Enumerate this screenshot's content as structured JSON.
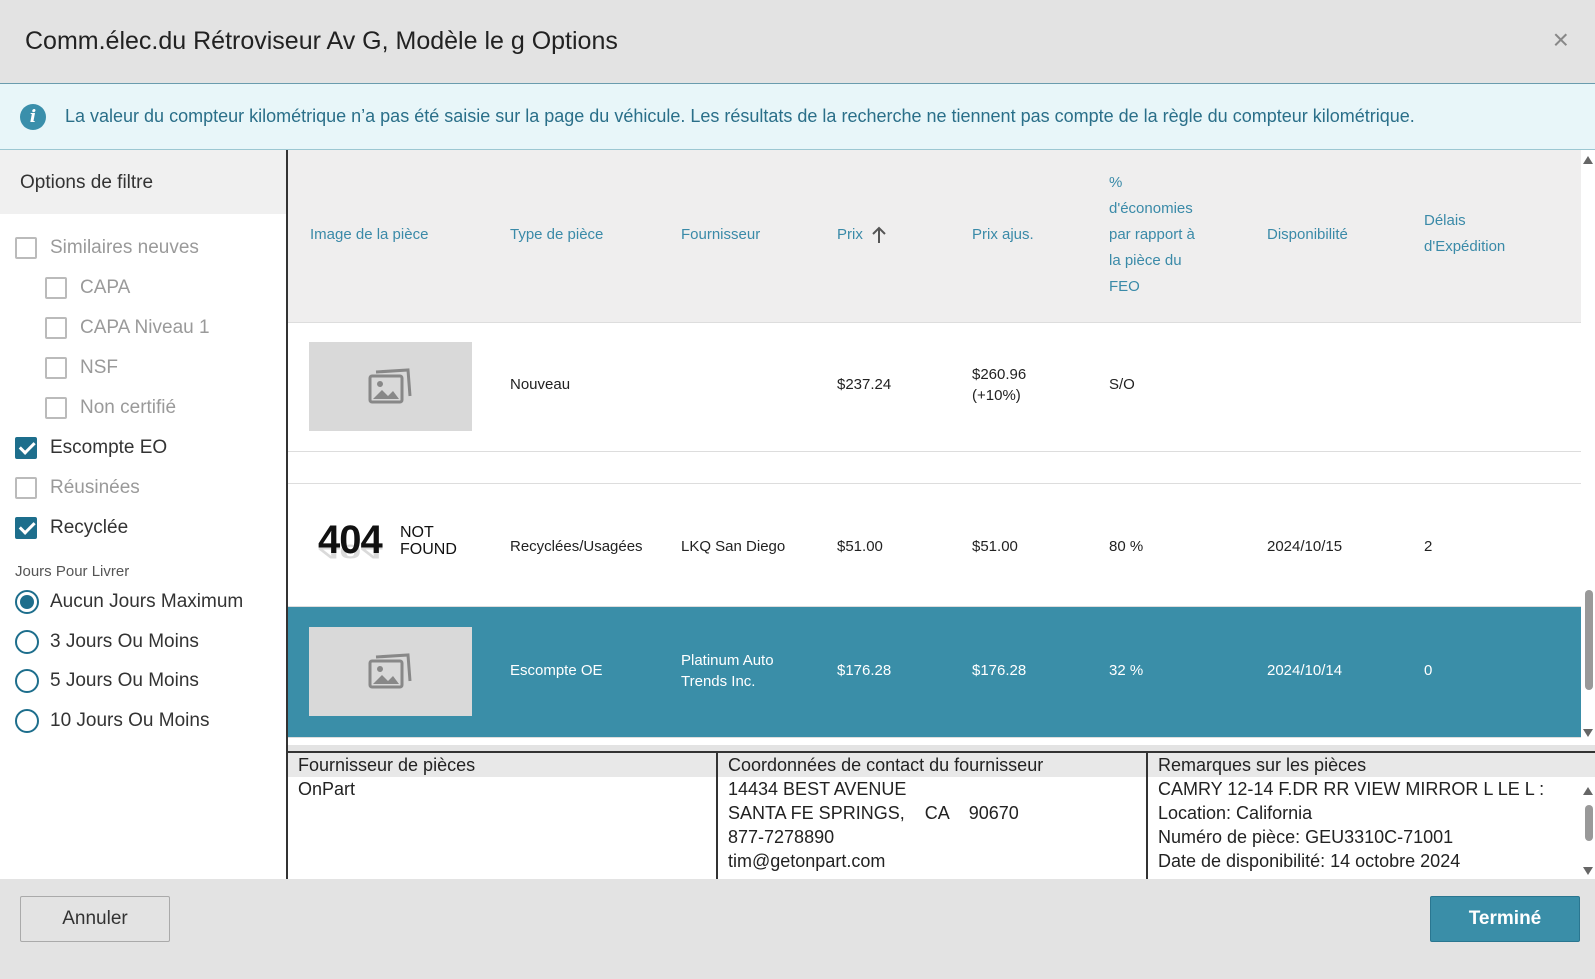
{
  "dialog": {
    "title": "Comm.élec.du Rétroviseur Av G, Modèle le g Options",
    "close_icon": "×"
  },
  "info_banner": {
    "icon": "info-icon",
    "text": "La valeur du compteur kilométrique n’a pas été saisie sur la page du véhicule. Les résultats de la recherche ne tiennent pas compte de la règle du compteur kilométrique."
  },
  "sidebar": {
    "title": "Options de filtre",
    "checkboxes": [
      {
        "label": "Similaires neuves",
        "checked": false,
        "enabled": false
      },
      {
        "label": "CAPA",
        "checked": false,
        "enabled": false
      },
      {
        "label": "CAPA Niveau 1",
        "checked": false,
        "enabled": false
      },
      {
        "label": "NSF",
        "checked": false,
        "enabled": false
      },
      {
        "label": "Non certifié",
        "checked": false,
        "enabled": false
      },
      {
        "label": "Escompte EO",
        "checked": true,
        "enabled": true
      },
      {
        "label": "Réusinées",
        "checked": false,
        "enabled": false
      },
      {
        "label": "Recyclée",
        "checked": true,
        "enabled": true
      }
    ],
    "delivery_label": "Jours Pour Livrer",
    "radios": [
      {
        "label": "Aucun Jours Maximum",
        "selected": true
      },
      {
        "label": "3 Jours Ou Moins",
        "selected": false
      },
      {
        "label": "5 Jours Ou Moins",
        "selected": false
      },
      {
        "label": "10 Jours Ou Moins",
        "selected": false
      }
    ]
  },
  "table": {
    "headers": {
      "image": "Image de la pièce",
      "type": "Type de pièce",
      "supplier": "Fournisseur",
      "price": "Prix",
      "adj_price": "Prix ajus.",
      "savings": "% d'économies par rapport à la pièce du FEO",
      "availability": "Disponibilité",
      "delay": "Délais d'Expédition"
    },
    "sort_icon": "arrow-up-icon",
    "rows": [
      {
        "image": "placeholder",
        "type": "Nouveau",
        "supplier": "",
        "price": "$237.24",
        "adj_price": "$260.96",
        "adj_pct": "(+10%)",
        "savings": "S/O",
        "availability": "",
        "delay": "",
        "selected": false
      },
      {
        "image": "not-found",
        "type": "Recyclées/Usagées",
        "supplier": "LKQ San Diego",
        "price": "$51.00",
        "adj_price": "$51.00",
        "adj_pct": "",
        "savings": "80 %",
        "availability": "2024/10/15",
        "delay": "2",
        "selected": false
      },
      {
        "image": "placeholder",
        "type": "Escompte OE",
        "supplier": "Platinum Auto Trends Inc.",
        "price": "$176.28",
        "adj_price": "$176.28",
        "adj_pct": "",
        "savings": "32 %",
        "availability": "2024/10/14",
        "delay": "0",
        "selected": true
      }
    ],
    "not_found": {
      "big": "404",
      "small1": "NOT",
      "small2": "FOUND"
    }
  },
  "details": {
    "supplier": {
      "header": "Fournisseur de pièces",
      "name": "OnPart"
    },
    "contact": {
      "header": "Coordonnées de contact du fournisseur",
      "address": "14434 BEST AVENUE",
      "city_line": "SANTA FE SPRINGS,    CA    90670",
      "phone": "877-7278890",
      "email": "tim@getonpart.com"
    },
    "remarks": {
      "header": "Remarques sur les pièces",
      "line1": "CAMRY 12-14 F.DR RR VIEW MIRROR L LE L :",
      "line2": "Location: California",
      "line3": "Numéro de pièce: GEU3310C-71001",
      "line4": "Date de disponibilité: 14 octobre 2024"
    }
  },
  "footer": {
    "cancel_label": "Annuler",
    "done_label": "Terminé"
  },
  "colors": {
    "accent": "#3a8ea8",
    "dark_accent": "#1d6e8c",
    "info_bg": "#e8f6f9"
  }
}
